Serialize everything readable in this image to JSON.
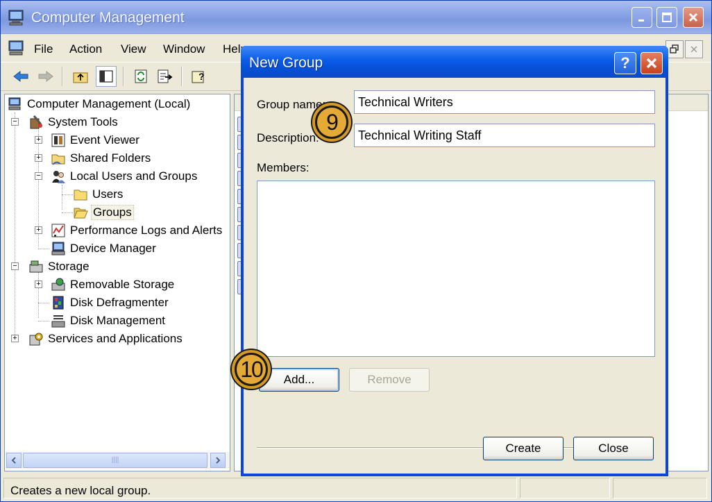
{
  "window": {
    "title": "Computer Management",
    "menu": [
      "File",
      "Action",
      "View",
      "Window",
      "Help"
    ]
  },
  "tree": {
    "root": "Computer Management (Local)",
    "system_tools": "System Tools",
    "event_viewer": "Event Viewer",
    "shared_folders": "Shared Folders",
    "local_users_groups": "Local Users and Groups",
    "users": "Users",
    "groups": "Groups",
    "perf_logs": "Performance Logs and Alerts",
    "device_manager": "Device Manager",
    "storage": "Storage",
    "removable_storage": "Removable Storage",
    "disk_defrag": "Disk Defragmenter",
    "disk_management": "Disk Management",
    "services_apps": "Services and Applications"
  },
  "statusbar": {
    "text": "Creates a new local group."
  },
  "dialog": {
    "title": "New Group",
    "group_name_label": "Group name:",
    "group_name_value": "Technical Writers",
    "description_label": "Description:",
    "description_value": "Technical Writing Staff",
    "members_label": "Members:",
    "add_label": "Add...",
    "remove_label": "Remove",
    "create_label": "Create",
    "close_label": "Close"
  },
  "callouts": {
    "step9": "9",
    "step10": "10",
    "color": "#e5a936"
  },
  "colors": {
    "xp_blue": "#0a46d8",
    "dialog_bg": "#ece9d8",
    "selection": "#f5f3e6"
  }
}
